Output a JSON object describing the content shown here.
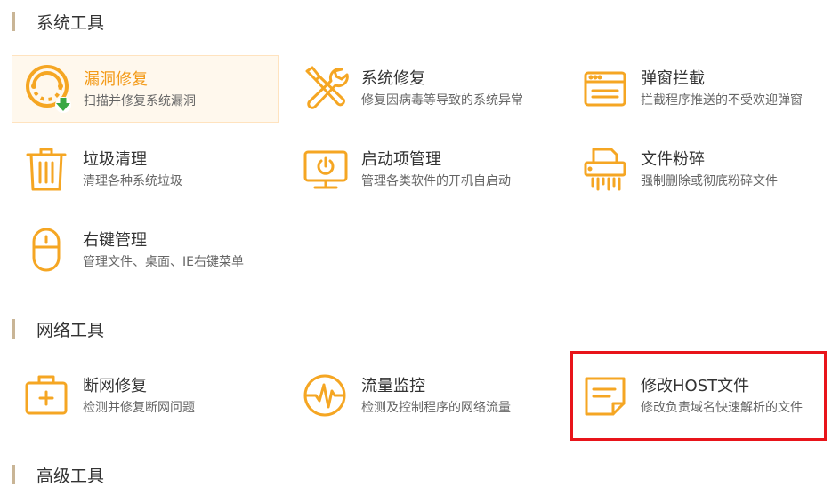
{
  "colors": {
    "accent": "#f5a623",
    "active_text": "#f39a18",
    "highlight": "#e8141a"
  },
  "sections": [
    {
      "title": "系统工具"
    },
    {
      "title": "网络工具"
    },
    {
      "title": "高级工具"
    }
  ],
  "tools": {
    "vuln_fix": {
      "title": "漏洞修复",
      "desc": "扫描并修复系统漏洞",
      "icon": "vulnerability-fix-icon"
    },
    "system_fix": {
      "title": "系统修复",
      "desc": "修复因病毒等导致的系统异常",
      "icon": "wrench-screwdriver-icon"
    },
    "popup_block": {
      "title": "弹窗拦截",
      "desc": "拦截程序推送的不受欢迎弹窗",
      "icon": "browser-window-icon"
    },
    "junk_clean": {
      "title": "垃圾清理",
      "desc": "清理各种系统垃圾",
      "icon": "trash-icon"
    },
    "startup_mgr": {
      "title": "启动项管理",
      "desc": "管理各类软件的开机自启动",
      "icon": "monitor-power-icon"
    },
    "file_shred": {
      "title": "文件粉碎",
      "desc": "强制删除或彻底粉碎文件",
      "icon": "shredder-icon"
    },
    "context_menu": {
      "title": "右键管理",
      "desc": "管理文件、桌面、IE右键菜单",
      "icon": "mouse-icon"
    },
    "net_fix": {
      "title": "断网修复",
      "desc": "检测并修复断网问题",
      "icon": "first-aid-kit-icon"
    },
    "traffic_mon": {
      "title": "流量监控",
      "desc": "检测及控制程序的网络流量",
      "icon": "pulse-gauge-icon"
    },
    "host_edit": {
      "title": "修改HOST文件",
      "desc": "修改负责域名快速解析的文件",
      "icon": "note-file-icon"
    }
  }
}
